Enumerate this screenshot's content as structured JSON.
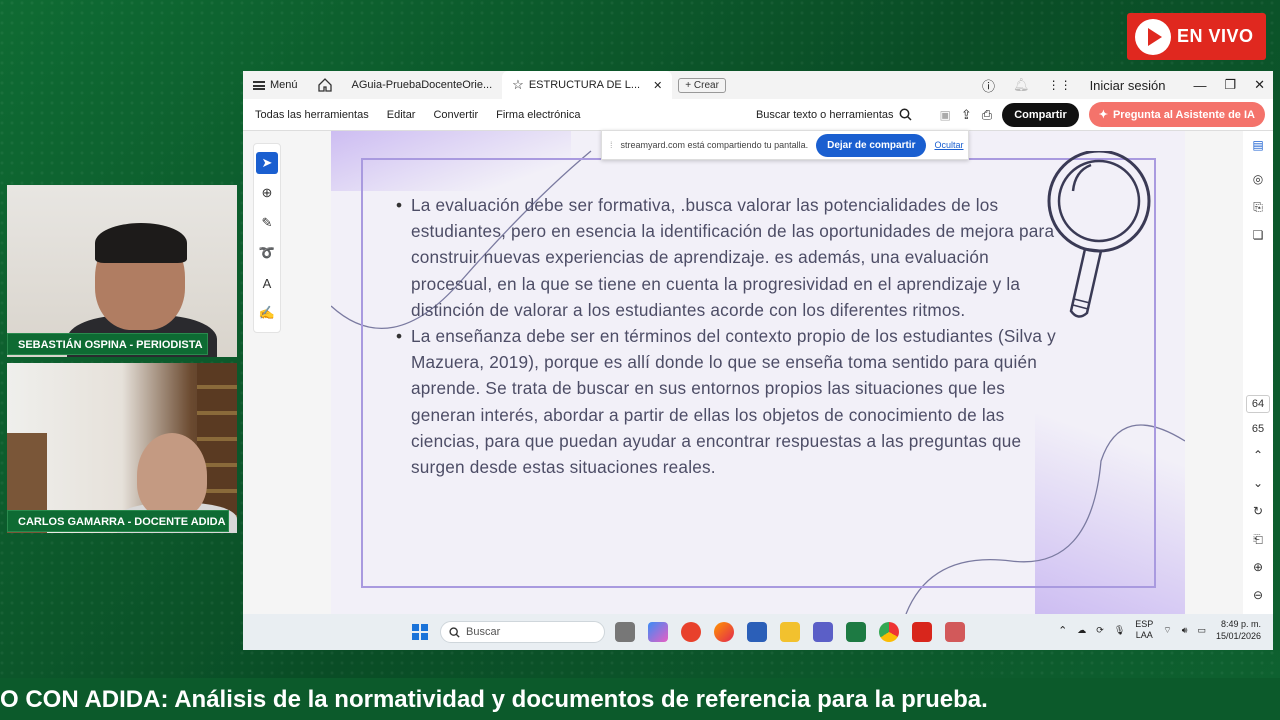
{
  "live_badge": {
    "label": "EN VIVO"
  },
  "cameras": [
    {
      "name_label": "SEBASTIÁN OSPINA - PERIODISTA"
    },
    {
      "name_label": "CARLOS GAMARRA - DOCENTE ADIDA"
    }
  ],
  "app": {
    "menu_label": "Menú",
    "tabs": [
      {
        "label": "AGuia-PruebaDocenteOrie..."
      },
      {
        "label": "ESTRUCTURA DE L..."
      }
    ],
    "new_tab_label": "Crear",
    "login_label": "Iniciar sesión",
    "toolbar": {
      "all_tools": "Todas las herramientas",
      "edit": "Editar",
      "convert": "Convertir",
      "esign": "Firma electrónica",
      "search": "Buscar texto o herramientas",
      "share": "Compartir",
      "ai": "Pregunta al Asistente de IA"
    },
    "share_notice": {
      "text": "streamyard.com está compartiendo tu pantalla.",
      "stop": "Dejar de compartir",
      "hide": "Ocultar"
    },
    "document": {
      "bullets": [
        "La evaluación debe ser formativa, .busca valorar las potencialidades de los estudiantes, pero en esencia la identificación de las oportunidades de mejora para construir nuevas experiencias de aprendizaje. es además, una evaluación procesual, en la que se tiene en cuenta la progresividad en el aprendizaje y la distinción de valorar a los estudiantes acorde con los diferentes ritmos.",
        "La enseñanza debe ser en términos del contexto propio de los estudiantes (Silva y Mazuera, 2019), porque es allí donde lo que se enseña toma sentido para quién aprende. Se trata de buscar en sus entornos propios las situaciones que les generan interés, abordar a partir de ellas los objetos de conocimiento de las ciencias, para que puedan ayudar a encontrar respuestas a las preguntas que surgen desde estas situaciones reales."
      ]
    },
    "page_numbers": {
      "current": "64",
      "next": "65"
    }
  },
  "taskbar": {
    "search_placeholder": "Buscar",
    "lang_top": "ESP",
    "lang_bottom": "LAA",
    "time": "8:49 p. m.",
    "date": "15/01/2026"
  },
  "ticker": {
    "text": "O CON ADIDA: Análisis de la normatividad y documentos de referencia para la prueba."
  },
  "colors": {
    "accent_green": "#0c5a2b",
    "live_red": "#e0281f",
    "share_blue": "#1a5fd0",
    "ai_coral": "#f4736b"
  }
}
